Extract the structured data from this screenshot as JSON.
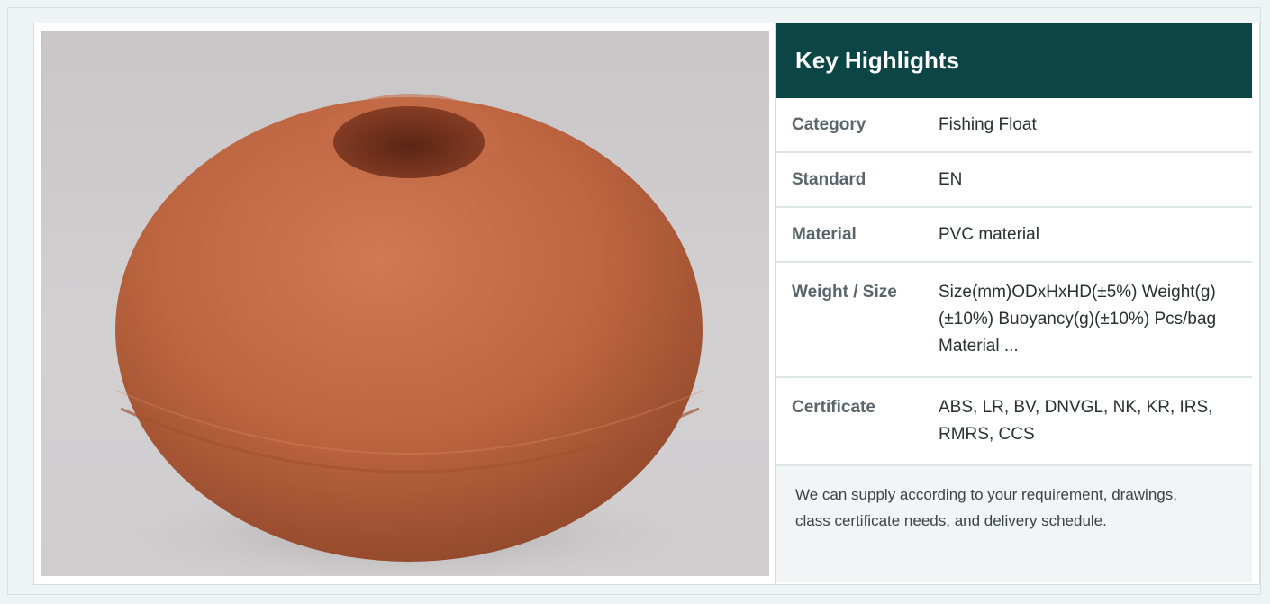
{
  "header": {
    "title": "Key Highlights"
  },
  "specs": [
    {
      "label": "Category",
      "value": "Fishing Float"
    },
    {
      "label": "Standard",
      "value": "EN"
    },
    {
      "label": "Material",
      "value": "PVC material"
    },
    {
      "label": "Weight / Size",
      "value": "Size(mm)ODxHxHD(±5%) Weight(g)(±10%) Buoyancy(g)(±10%) Pcs/bag Material ..."
    },
    {
      "label": "Certificate",
      "value": "ABS, LR, BV, DNVGL, NK, KR, IRS, RMRS, CCS"
    }
  ],
  "note": "We can supply according to your requirement, drawings, class certificate needs, and delivery schedule.",
  "colors": {
    "header_bg": "#0c4545",
    "float_body": "#b8603e"
  }
}
